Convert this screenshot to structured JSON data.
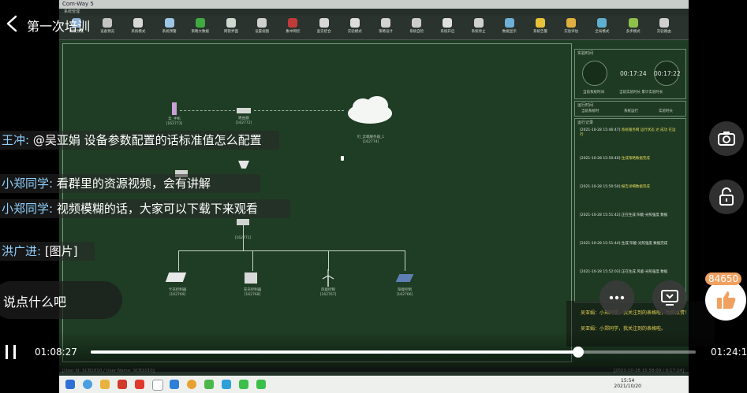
{
  "stream": {
    "title": "第一次培训",
    "comment_placeholder": "说点什么吧",
    "like_count": "84650",
    "icons": {
      "back": "chevron-left-icon",
      "camera": "camera-icon",
      "lock": "unlock-icon",
      "more": "more-icon",
      "tv": "cast-tv-icon",
      "like": "thumbs-up-icon",
      "pause": "pause-icon"
    },
    "like_color": "#f0a060"
  },
  "chat": [
    {
      "user": "王冲:",
      "text": " @吴亚娟 设备参数配置的话标准值怎么配置"
    },
    {
      "user": "小郑同学:",
      "text": " 看群里的资源视频，会有讲解"
    },
    {
      "user": "小郑同学:",
      "text": " 视频模糊的话，大家可以下载下来观看"
    },
    {
      "user": "洪广进:",
      "text": " [图片]"
    }
  ],
  "danmaku": [
    "吴亚娟：小郑同学，我关注到的表格啦，为你点赞！",
    "吴亚娟：小郑同学，我关注到的表格啦。"
  ],
  "player": {
    "current_time": "01:08:27",
    "total_time": "01:24:10",
    "progress": 0.806
  },
  "app": {
    "title": "Com-Way 5",
    "toolbar": [
      {
        "label": "场景预览",
        "color": "#8fb0d6"
      },
      {
        "label": "设备预览",
        "color": "#c4c4c4"
      },
      {
        "label": "系统模式",
        "color": "#d8d8d8"
      },
      {
        "label": "系统预警",
        "color": "#9ec6e6"
      },
      {
        "label": "策略大数据",
        "color": "#3faa3f"
      },
      {
        "label": "网管界面",
        "color": "#cfd8cf"
      },
      {
        "label": "设置视图",
        "color": "#d0d0d0"
      },
      {
        "label": "集中网控",
        "color": "#c23b3b"
      },
      {
        "label": "查实结合",
        "color": "#d8d8d8"
      },
      {
        "label": "实验模式",
        "color": "#dddddd"
      },
      {
        "label": "策略设计",
        "color": "#d2d2d2"
      },
      {
        "label": "系统自检",
        "color": "#cccccc"
      },
      {
        "label": "系统开启",
        "color": "#e0e0e0"
      },
      {
        "label": "系统停止",
        "color": "#d0d0d0"
      },
      {
        "label": "数据显示",
        "color": "#6fb0d8"
      },
      {
        "label": "系统告警",
        "color": "#e8c33a"
      },
      {
        "label": "实验评估",
        "color": "#e0b040"
      },
      {
        "label": "全局模式",
        "color": "#5fb0d0"
      },
      {
        "label": "多步模式",
        "color": "#8fc04a"
      },
      {
        "label": "实验路由",
        "color": "#cfcfcf"
      }
    ],
    "nodes": {
      "cloud_label": "钉_云端服务器_1",
      "cloud_id": "[162774]",
      "phone_label": "云_手机",
      "phone_id": "[162773]",
      "server_label": "路由器",
      "server_id": "[162772]",
      "gateway_id": "[162771]",
      "bottom": [
        {
          "label": "卡充控制器",
          "id": "[162769]"
        },
        {
          "label": "充充控制器",
          "id": "[162768]"
        },
        {
          "label": "风能控制",
          "id": "[162767]"
        },
        {
          "label": "阳能控制",
          "id": "[162766]"
        }
      ]
    },
    "right_panel": {
      "experiment_time_title": "实验时间",
      "time_current": "00:17:24",
      "time_total": "00:17:22",
      "label_current": "当前系统时间",
      "label_total": "当前实验时长 累计实验时长",
      "run_title": "运行时间",
      "mode_a": "当前系统时",
      "mode_b": "系统运行",
      "mode_c": "实验时长",
      "log_title": "运行记录",
      "logs": [
        {
          "ts": "[2021-10-28 15:46:47]:",
          "text": "系统服务网 运行状态 达 成功 在运行",
          "warn": true
        },
        {
          "ts": "[2021-10-28 15:50:40]:",
          "text": "生成策略数据完成",
          "warn": true
        },
        {
          "ts": "[2021-10-28 15:50:50]:",
          "text": "报告详细数据完成",
          "warn": true
        },
        {
          "ts": "[2021-10-28 15:51:42]:",
          "text": "正在生成 阳能-光照强度 数据",
          "warn": false
        },
        {
          "ts": "[2021-10-28 15:51:44]:",
          "text": "生成 阳能-光照强度 数据完成",
          "warn": false
        },
        {
          "ts": "[2021-10-28 15:52:03]:",
          "text": "正在生成 风能-光照强度 数据",
          "warn": false
        }
      ]
    },
    "status": {
      "user": "[User Id: SCB1010 / User Name: SCB1010]",
      "right": "[2021-10-28 15:58:09 / 0:17:24]"
    },
    "tray": {
      "time": "15:54",
      "date": "2021/10/20"
    }
  }
}
